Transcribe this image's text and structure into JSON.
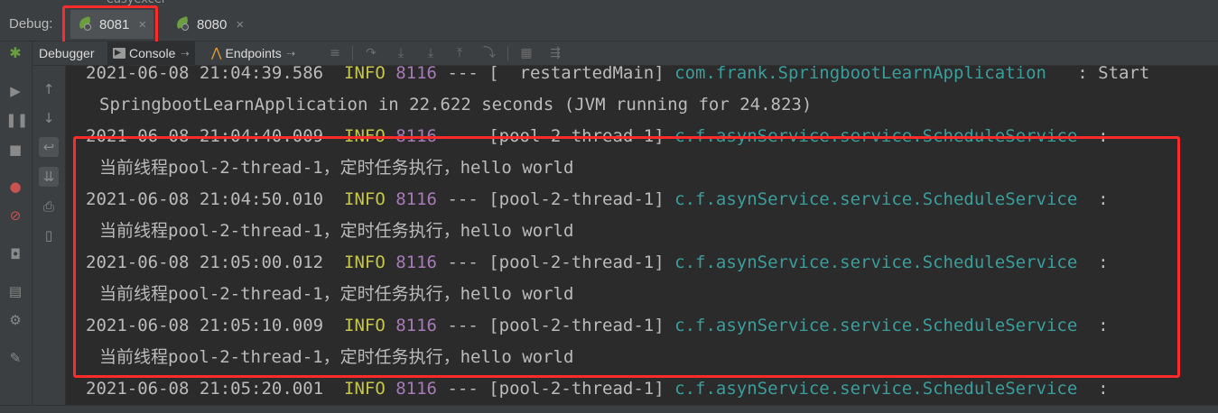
{
  "top_crumb": "easyexcel",
  "debug_bar": {
    "label": "Debug:",
    "tabs": [
      {
        "label": "8081",
        "close": "×"
      },
      {
        "label": "8080",
        "close": "×"
      }
    ]
  },
  "toolbar": {
    "debugger_label": "Debugger",
    "console_label": "Console",
    "endpoints_label": "Endpoints",
    "pin_glyph": "⇢"
  },
  "console": {
    "lines": [
      {
        "ts": "2021-06-08 21:04:39.586",
        "level": "INFO",
        "pid": "8116",
        "sep": "---",
        "thread": "[  restartedMain]",
        "logger": "com.frank.SpringbootLearnApplication",
        "tail": "   : Start"
      },
      {
        "msg": "SpringbootLearnApplication in 22.622 seconds (JVM running for 24.823)"
      },
      {
        "ts": "2021-06-08 21:04:40.009",
        "level": "INFO",
        "pid": "8116",
        "sep": "---",
        "thread": "[pool-2-thread-1]",
        "logger": "c.f.asynService.service.ScheduleService",
        "tail": "  :"
      },
      {
        "msg": "当前线程pool-2-thread-1，定时任务执行，hello world"
      },
      {
        "ts": "2021-06-08 21:04:50.010",
        "level": "INFO",
        "pid": "8116",
        "sep": "---",
        "thread": "[pool-2-thread-1]",
        "logger": "c.f.asynService.service.ScheduleService",
        "tail": "  :"
      },
      {
        "msg": "当前线程pool-2-thread-1，定时任务执行，hello world"
      },
      {
        "ts": "2021-06-08 21:05:00.012",
        "level": "INFO",
        "pid": "8116",
        "sep": "---",
        "thread": "[pool-2-thread-1]",
        "logger": "c.f.asynService.service.ScheduleService",
        "tail": "  :"
      },
      {
        "msg": "当前线程pool-2-thread-1，定时任务执行，hello world"
      },
      {
        "ts": "2021-06-08 21:05:10.009",
        "level": "INFO",
        "pid": "8116",
        "sep": "---",
        "thread": "[pool-2-thread-1]",
        "logger": "c.f.asynService.service.ScheduleService",
        "tail": "  :"
      },
      {
        "msg": "当前线程pool-2-thread-1，定时任务执行，hello world"
      },
      {
        "ts": "2021-06-08 21:05:20.001",
        "level": "INFO",
        "pid": "8116",
        "sep": "---",
        "thread": "[pool-2-thread-1]",
        "logger": "c.f.asynService.service.ScheduleService",
        "tail": "  :"
      }
    ]
  },
  "colors": {
    "background": "#2b2b2b",
    "panel": "#3c3f41",
    "info": "#c7c747",
    "pid": "#a77ab9",
    "logger": "#3a9e9c",
    "highlight": "#ff2a2a"
  },
  "icons": {
    "left_bar": [
      "debug-bug-icon",
      "resume-icon",
      "pause-icon",
      "stop-icon",
      "breakpoints-icon",
      "mute-breakpoints-icon",
      "camera-icon",
      "layout-icon",
      "settings-icon",
      "pin-icon"
    ],
    "console_side": [
      "scroll-up-icon",
      "scroll-down-icon",
      "soft-wrap-icon",
      "scroll-to-end-icon",
      "print-icon",
      "clear-icon"
    ]
  }
}
